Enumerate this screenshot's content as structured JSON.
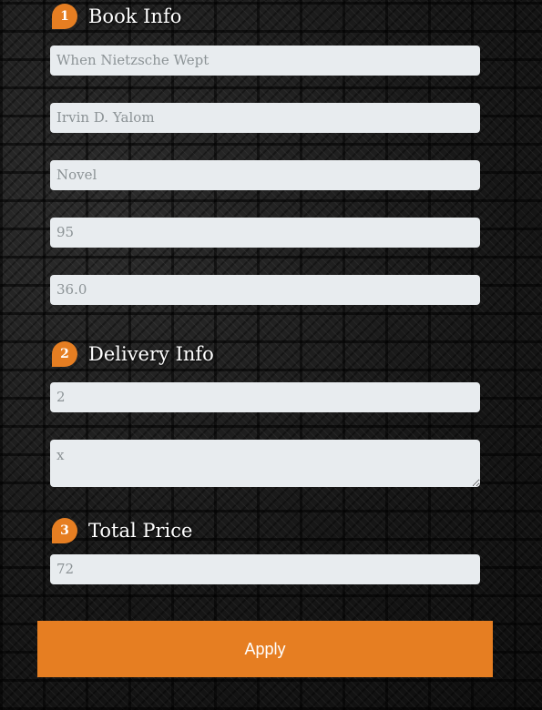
{
  "sections": [
    {
      "number": "1",
      "title": "Book Info"
    },
    {
      "number": "2",
      "title": "Delivery Info"
    },
    {
      "number": "3",
      "title": "Total Price"
    }
  ],
  "book_info": {
    "title_value": "When Nietzsche Wept",
    "author_value": "Irvin D. Yalom",
    "genre_value": "Novel",
    "quantity_value": "95",
    "price_value": "36.0"
  },
  "delivery_info": {
    "delivery_value": "2",
    "address_value": "x"
  },
  "total_price": {
    "total_value": "72"
  },
  "apply_label": "Apply",
  "colors": {
    "accent": "#e67e22",
    "field_bg": "#e8ecef",
    "field_text": "#8c9396"
  }
}
